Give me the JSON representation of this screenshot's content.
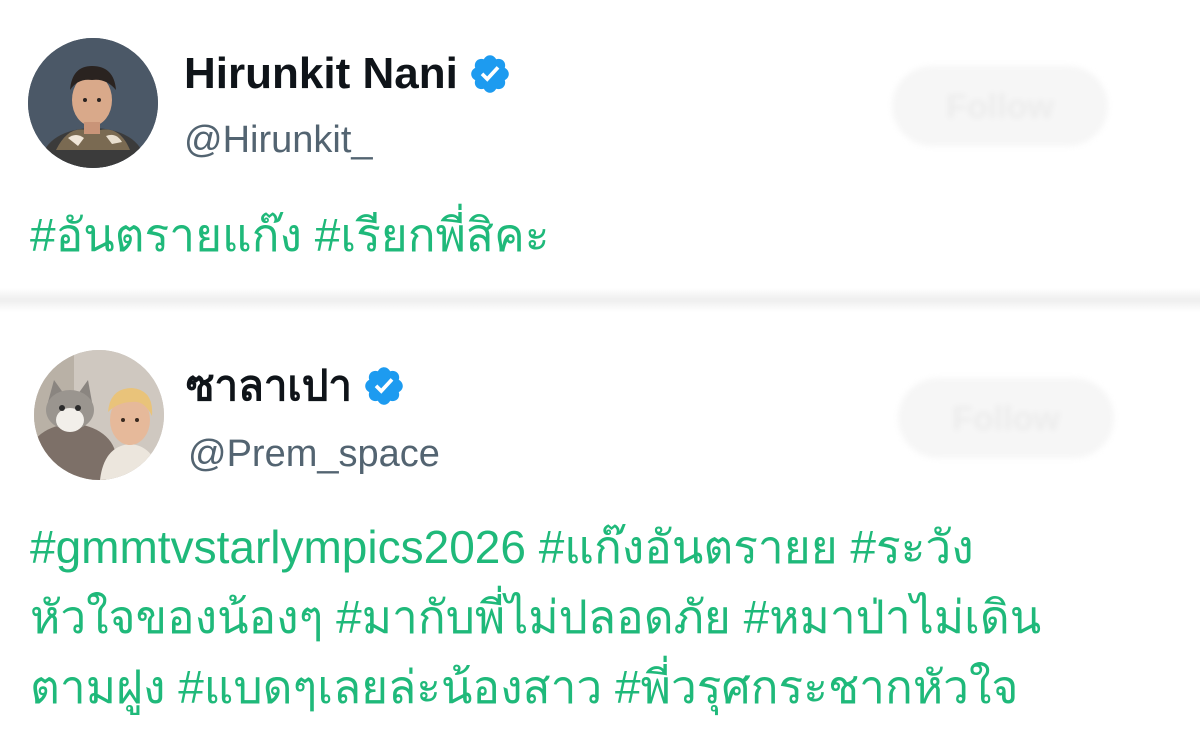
{
  "tweets": [
    {
      "display_name": "Hirunkit Nani",
      "handle": "@Hirunkit_",
      "verified": true,
      "follow_label": "Follow",
      "text_lines": [
        "#อันตรายแก๊ง #เรียกพี่สิคะ"
      ]
    },
    {
      "display_name": "ซาลาเปา",
      "handle": "@Prem_space",
      "verified": true,
      "follow_label": "Follow",
      "text_lines": [
        "#gmmtvstarlympics2026 #แก๊งอันตรายย #ระวัง",
        "หัวใจของน้องๆ #มากับพี่ไม่ปลอดภัย #หมาป่าไม่เดิน",
        "ตามฝูง #แบดๆเลยล่ะน้องสาว #พี่วรุศกระชากหัวใจ"
      ]
    }
  ],
  "colors": {
    "hashtag": "#1fb97a",
    "verified_badge": "#1d9bf0",
    "name": "#0f1419",
    "handle": "#536471"
  },
  "icons": {
    "verified": "verified-badge-icon",
    "avatar_1": "profile-photo-man",
    "avatar_2": "profile-photo-man-with-cat"
  }
}
